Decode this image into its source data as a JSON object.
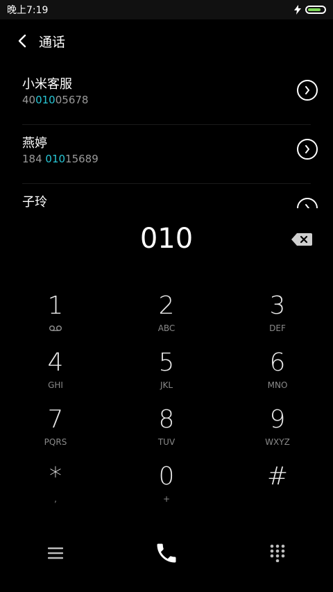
{
  "status": {
    "time": "晚上7:19"
  },
  "header": {
    "title": "通话"
  },
  "results": [
    {
      "name": "小米客服",
      "number_pre": "40",
      "number_match": "010",
      "number_post": "05678"
    },
    {
      "name": "燕婷",
      "number_pre": "184 ",
      "number_match": "010",
      "number_post": "15689"
    },
    {
      "name": "子玲",
      "number_pre": "",
      "number_match": "",
      "number_post": ""
    }
  ],
  "dial": {
    "entered": "010"
  },
  "keys": [
    {
      "main": "1",
      "sub": ""
    },
    {
      "main": "2",
      "sub": "ABC"
    },
    {
      "main": "3",
      "sub": "DEF"
    },
    {
      "main": "4",
      "sub": "GHI"
    },
    {
      "main": "5",
      "sub": "JKL"
    },
    {
      "main": "6",
      "sub": "MNO"
    },
    {
      "main": "7",
      "sub": "PQRS"
    },
    {
      "main": "8",
      "sub": "TUV"
    },
    {
      "main": "9",
      "sub": "WXYZ"
    },
    {
      "main": "*",
      "sub": ","
    },
    {
      "main": "0",
      "sub": "+"
    },
    {
      "main": "#",
      "sub": ""
    }
  ],
  "colors": {
    "accent": "#28c7d6",
    "battery": "#7ed957"
  },
  "icons": {
    "back": "chevron-left-icon",
    "row_action": "chevron-right-circle-icon",
    "backspace": "backspace-icon",
    "menu": "menu-icon",
    "call": "phone-icon",
    "dialpad": "dialpad-icon"
  }
}
